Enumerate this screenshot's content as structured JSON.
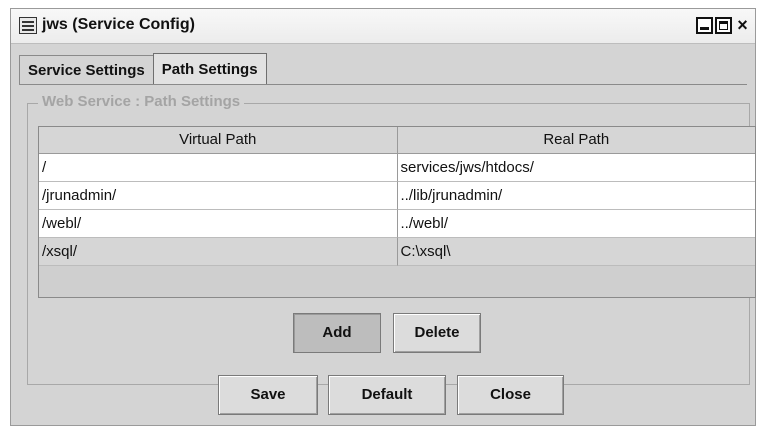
{
  "window": {
    "title": "jws (Service Config)"
  },
  "tabs": [
    {
      "label": "Service Settings"
    },
    {
      "label": "Path Settings"
    }
  ],
  "group": {
    "title": "Web Service : Path Settings"
  },
  "table": {
    "columns": [
      "Virtual Path",
      "Real Path"
    ],
    "rows": [
      [
        "/",
        "services/jws/htdocs/"
      ],
      [
        "/jrunadmin/",
        "../lib/jrunadmin/"
      ],
      [
        "/webl/",
        "../webl/"
      ],
      [
        "/xsql/",
        "C:\\xsql\\"
      ]
    ]
  },
  "table_actions": {
    "add_label": "Add",
    "delete_label": "Delete"
  },
  "footer": {
    "save_label": "Save",
    "default_label": "Default",
    "close_label": "Close"
  }
}
